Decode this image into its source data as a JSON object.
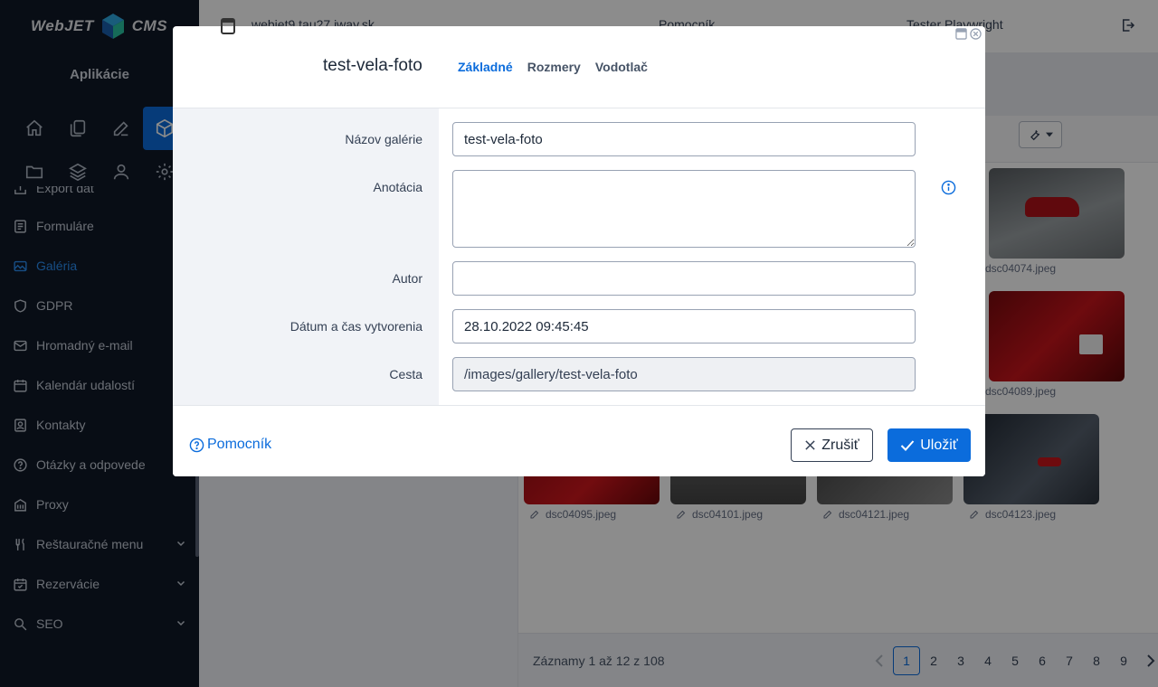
{
  "app": {
    "logo_text_left": "WebJET",
    "logo_text_right": "CMS",
    "apps_title": "Aplikácie"
  },
  "sidebar": {
    "icon_rows": [
      [
        "home-icon",
        "pages-icon",
        "edit-icon",
        "cube-icon"
      ],
      [
        "folder-icon",
        "layers-icon",
        "user-icon",
        "gear-icon"
      ]
    ],
    "items": [
      {
        "label": "Export dát",
        "icon": "export-icon"
      },
      {
        "label": "Formuláre",
        "icon": "form-icon"
      },
      {
        "label": "Galéria",
        "icon": "gallery-icon",
        "active": true
      },
      {
        "label": "GDPR",
        "icon": "shield-icon"
      },
      {
        "label": "Hromadný e-mail",
        "icon": "mail-icon"
      },
      {
        "label": "Kalendár udalostí",
        "icon": "calendar-icon"
      },
      {
        "label": "Kontakty",
        "icon": "contact-icon"
      },
      {
        "label": "Otázky a odpovede",
        "icon": "question-icon"
      },
      {
        "label": "Proxy",
        "icon": "building-icon"
      },
      {
        "label": "Reštauračné menu",
        "icon": "fork-knife-icon",
        "expandable": true
      },
      {
        "label": "Rezervácie",
        "icon": "calendar-check-icon",
        "expandable": true
      },
      {
        "label": "SEO",
        "icon": "seo-icon",
        "expandable": true
      }
    ]
  },
  "topbar": {
    "site": "webjet9.tau27.iway.sk",
    "help": "Pomocník",
    "user": "Tester Playwright"
  },
  "gallery": {
    "thumbnails": [
      {
        "name": "dsc04074.jpeg"
      },
      {
        "name": "dsc04089.jpeg"
      },
      {
        "name": "dsc04095.jpeg"
      },
      {
        "name": "dsc04101.jpeg"
      },
      {
        "name": "dsc04121.jpeg"
      },
      {
        "name": "dsc04123.jpeg"
      }
    ],
    "records_info": "Záznamy 1 až 12 z 108",
    "pages": [
      "1",
      "2",
      "3",
      "4",
      "5",
      "6",
      "7",
      "8",
      "9"
    ],
    "current_page": "1"
  },
  "modal": {
    "title": "test-vela-foto",
    "tabs": [
      {
        "label": "Základné",
        "active": true
      },
      {
        "label": "Rozmery"
      },
      {
        "label": "Vodotlač"
      }
    ],
    "fields": {
      "name_label": "Názov galérie",
      "name_value": "test-vela-foto",
      "annotation_label": "Anotácia",
      "annotation_value": "",
      "author_label": "Autor",
      "author_value": "",
      "created_label": "Dátum a čas vytvorenia",
      "created_value": "28.10.2022 09:45:45",
      "path_label": "Cesta",
      "path_value": "/images/gallery/test-vela-foto"
    },
    "footer": {
      "help": "Pomocník",
      "cancel": "Zrušiť",
      "save": "Uložiť"
    }
  },
  "colors": {
    "accent": "#0b6cdc",
    "sidebar_bg": "#101827"
  }
}
